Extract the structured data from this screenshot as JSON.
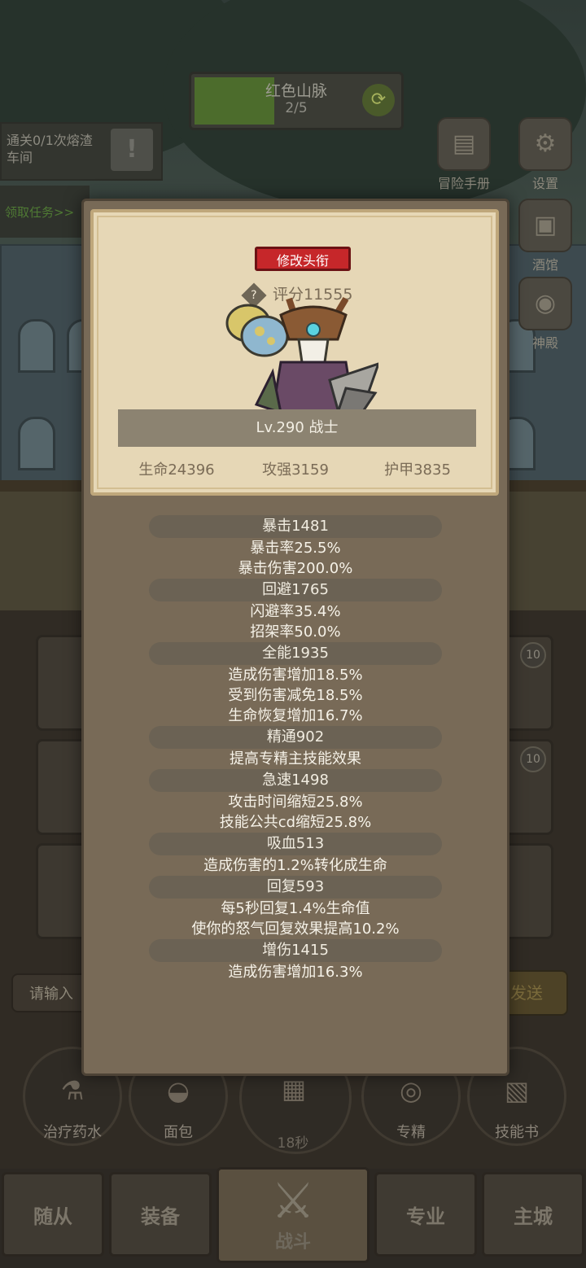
{
  "stage": {
    "name": "红色山脉",
    "progress": "2/5"
  },
  "quest": {
    "text": "通关0/1次熔渣车间",
    "alert": "!"
  },
  "claim_task": "领取任务>>",
  "right_menu": [
    {
      "label": "冒险手册",
      "icon": "book-icon"
    },
    {
      "label": "设置",
      "icon": "gear-icon"
    },
    {
      "label": "酒馆",
      "icon": "tavern-icon"
    },
    {
      "label": "神殿",
      "icon": "helmet-icon"
    }
  ],
  "slots": {
    "left_levels": [
      "",
      "",
      ""
    ],
    "right_levels": [
      "10",
      "10",
      ""
    ]
  },
  "chat": {
    "placeholder": "请输入",
    "send": "发送"
  },
  "items": [
    {
      "label": "治疗药水",
      "icon": "potion-icon"
    },
    {
      "label": "面包",
      "icon": "bread-icon"
    },
    {
      "label": "",
      "icon": "chest-icon"
    },
    {
      "label": "专精",
      "icon": "specialization-icon"
    },
    {
      "label": "技能书",
      "icon": "skill-book-icon"
    }
  ],
  "chest_timer": "18秒",
  "nav": {
    "followers": "随从",
    "equipment": "装备",
    "battle": "战斗",
    "profession": "专业",
    "main_city": "主城"
  },
  "character": {
    "change_title": "修改头衔",
    "rating": "评分11555",
    "level": "Lv.290 战士",
    "hp": "生命24396",
    "attack": "攻强3159",
    "armor": "护甲3835"
  },
  "stats": [
    {
      "header": "暴击1481",
      "lines": [
        "暴击率25.5%",
        "暴击伤害200.0%"
      ]
    },
    {
      "header": "回避1765",
      "lines": [
        "闪避率35.4%",
        "招架率50.0%"
      ]
    },
    {
      "header": "全能1935",
      "lines": [
        "造成伤害增加18.5%",
        "受到伤害减免18.5%",
        "生命恢复增加16.7%"
      ]
    },
    {
      "header": "精通902",
      "lines": [
        "提高专精主技能效果"
      ]
    },
    {
      "header": "急速1498",
      "lines": [
        "攻击时间缩短25.8%",
        "技能公共cd缩短25.8%"
      ]
    },
    {
      "header": "吸血513",
      "lines": [
        "造成伤害的1.2%转化成生命"
      ]
    },
    {
      "header": "回复593",
      "lines": [
        "每5秒回复1.4%生命值",
        "使你的怒气回复效果提高10.2%"
      ]
    },
    {
      "header": "增伤1415",
      "lines": [
        "造成伤害增加16.3%"
      ]
    }
  ],
  "colors": {
    "title_button": "#c6272a",
    "panel": "#786a57",
    "card": "#e6d7b6",
    "stage_progress": "#4c6c2c"
  }
}
